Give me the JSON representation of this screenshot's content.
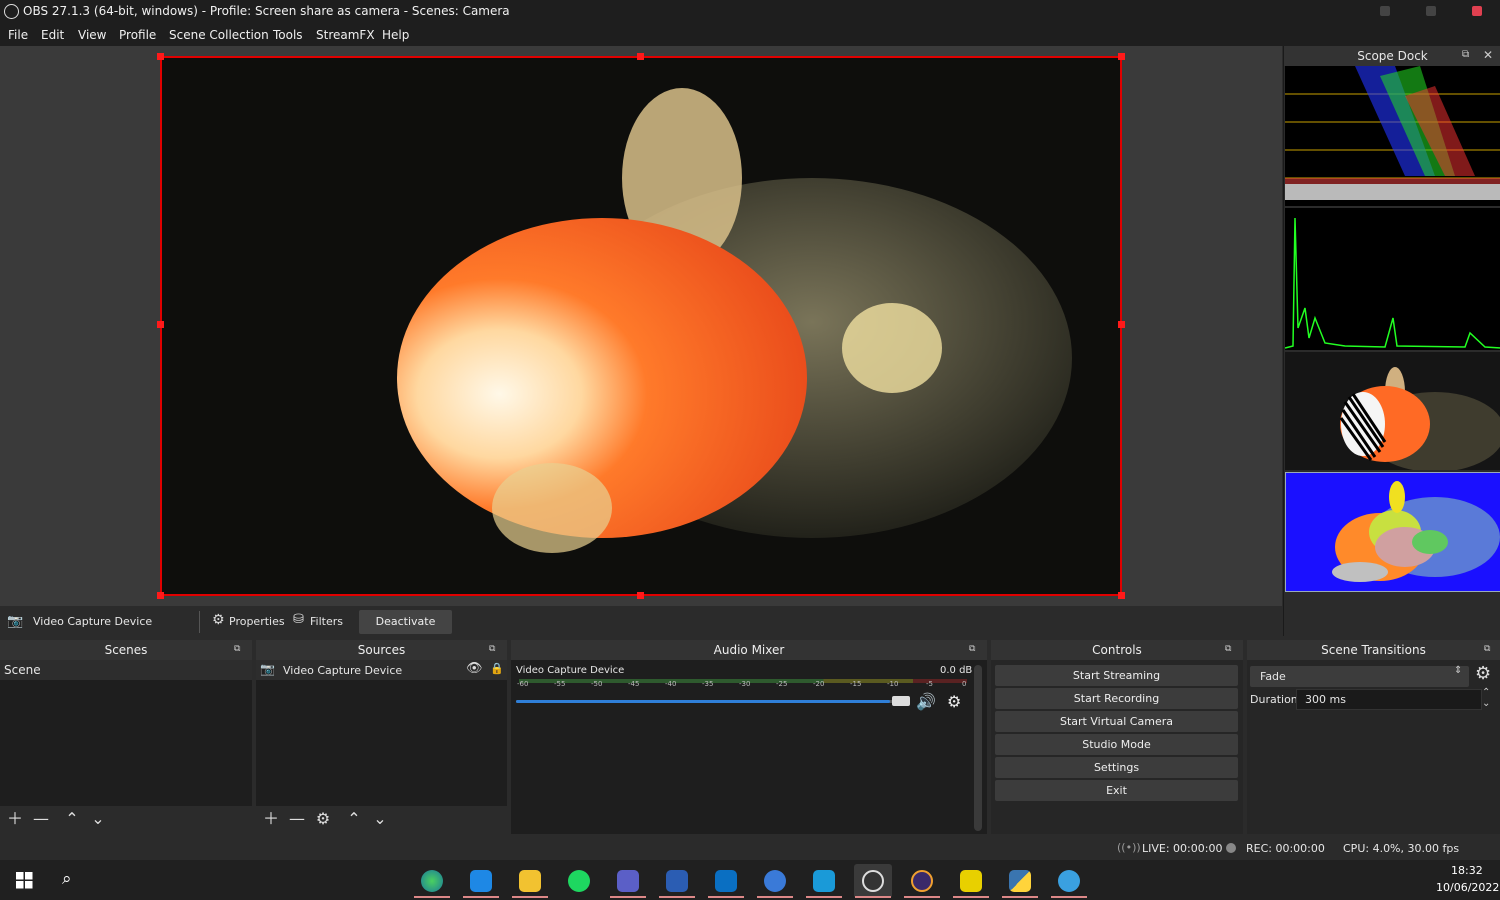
{
  "titlebar": {
    "title": "OBS 27.1.3 (64-bit, windows) - Profile: Screen share as camera - Scenes: Camera"
  },
  "menu": [
    "File",
    "Edit",
    "View",
    "Profile",
    "Scene Collection",
    "Tools",
    "StreamFX",
    "Help"
  ],
  "scope_dock": {
    "title": "Scope Dock"
  },
  "source_toolbar": {
    "source_name": "Video Capture Device",
    "properties": "Properties",
    "filters": "Filters",
    "deactivate": "Deactivate"
  },
  "scenes": {
    "title": "Scenes",
    "items": [
      "Scene"
    ]
  },
  "sources": {
    "title": "Sources",
    "items": [
      "Video Capture Device"
    ]
  },
  "audio_mixer": {
    "title": "Audio Mixer",
    "channel_name": "Video Capture Device",
    "level": "0.0 dB",
    "ticks": [
      "-60",
      "-55",
      "-50",
      "-45",
      "-40",
      "-35",
      "-30",
      "-25",
      "-20",
      "-15",
      "-10",
      "-5",
      "0"
    ],
    "volume_fraction": 0.95
  },
  "controls": {
    "title": "Controls",
    "buttons": [
      "Start Streaming",
      "Start Recording",
      "Start Virtual Camera",
      "Studio Mode",
      "Settings",
      "Exit"
    ]
  },
  "transitions": {
    "title": "Scene Transitions",
    "selected": "Fade",
    "duration_label": "Duration",
    "duration_value": "300 ms"
  },
  "status": {
    "live": "LIVE: 00:00:00",
    "rec": "REC: 00:00:00",
    "cpu": "CPU: 4.0%, 30.00 fps"
  },
  "taskbar": {
    "time": "18:32",
    "date": "10/06/2022",
    "apps": [
      "edge-dev",
      "vscode",
      "file-explorer",
      "spotify",
      "teams",
      "word",
      "outlook",
      "app-blue",
      "app-network",
      "obs",
      "eclipse",
      "fdm",
      "python",
      "app-globe"
    ]
  },
  "colors": {
    "accent_red": "#e00000",
    "volume_blue": "#2f7fd8",
    "background": "#2b2b2b",
    "panel": "#1e1e1e"
  }
}
